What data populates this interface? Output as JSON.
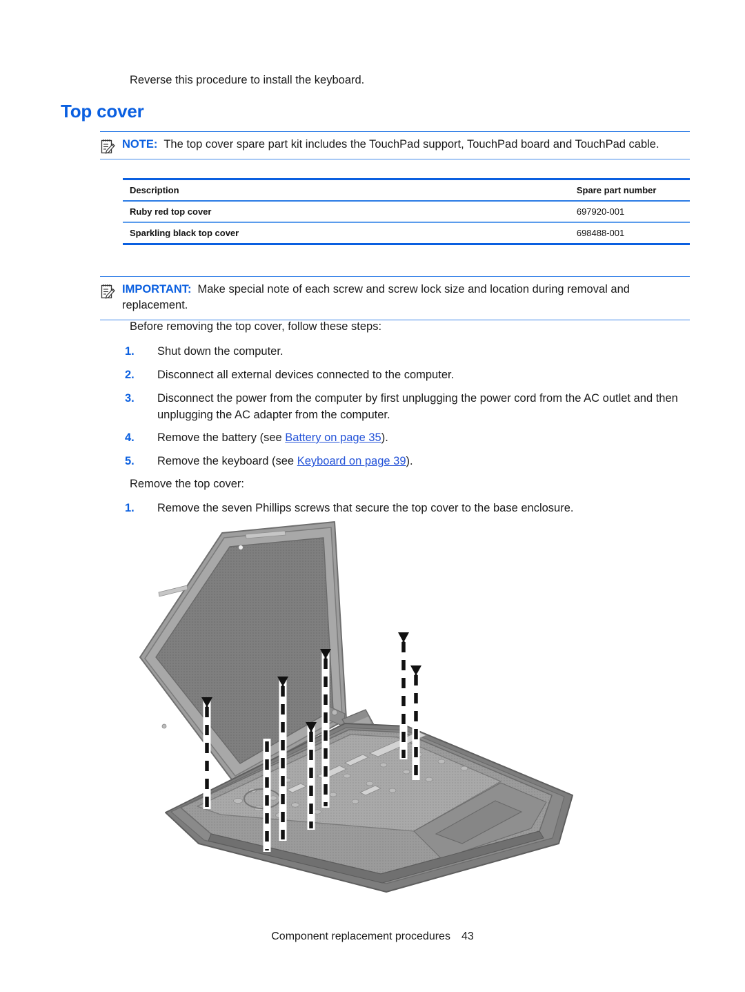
{
  "document": {
    "intro_line": "Reverse this procedure to install the keyboard.",
    "heading": "Top cover",
    "note": {
      "icon": "note-pad-pencil-icon",
      "label": "NOTE:",
      "text": "The top cover spare part kit includes the TouchPad support, TouchPad board and TouchPad cable."
    },
    "important": {
      "icon": "important-pad-pencil-icon",
      "label": "IMPORTANT:",
      "text": "Make special note of each screw and screw lock size and location during removal and replacement."
    },
    "spare_table": {
      "headers": [
        "Description",
        "Spare part number"
      ],
      "rows": [
        {
          "description": "Ruby red top cover",
          "part_number": "697920-001"
        },
        {
          "description": "Sparkling black top cover",
          "part_number": "698488-001"
        }
      ]
    },
    "before_paragraph": "Before removing the top cover, follow these steps:",
    "before_steps": [
      {
        "num": "1.",
        "text": "Shut down the computer."
      },
      {
        "num": "2.",
        "text": "Disconnect all external devices connected to the computer."
      },
      {
        "num": "3.",
        "text": "Disconnect the power from the computer by first unplugging the power cord from the AC outlet and then unplugging the AC adapter from the computer."
      },
      {
        "num": "4.",
        "prefix": "Remove the battery (see ",
        "link": "Battery on page 35",
        "suffix": ")."
      },
      {
        "num": "5.",
        "prefix": "Remove the keyboard (see ",
        "link": "Keyboard on page 39",
        "suffix": ")."
      }
    ],
    "remove_paragraph": "Remove the top cover:",
    "remove_steps": [
      {
        "num": "1.",
        "text": "Remove the seven Phillips screws that secure the top cover to the base enclosure."
      }
    ],
    "figure": {
      "name": "laptop-top-cover-screw-removal-illustration",
      "description": "Open laptop viewed at an angle with seven dashed screw callout arrows pointing down into the top cover",
      "screw_count": 7
    },
    "footer": {
      "title": "Component replacement procedures",
      "page_number": "43"
    },
    "colors": {
      "heading_blue": "#0a5fe0",
      "rule_blue": "#3d86e8",
      "link_blue": "#2453d8",
      "table_rule": "#5b9cec",
      "body_text": "#1a1a1a"
    }
  }
}
